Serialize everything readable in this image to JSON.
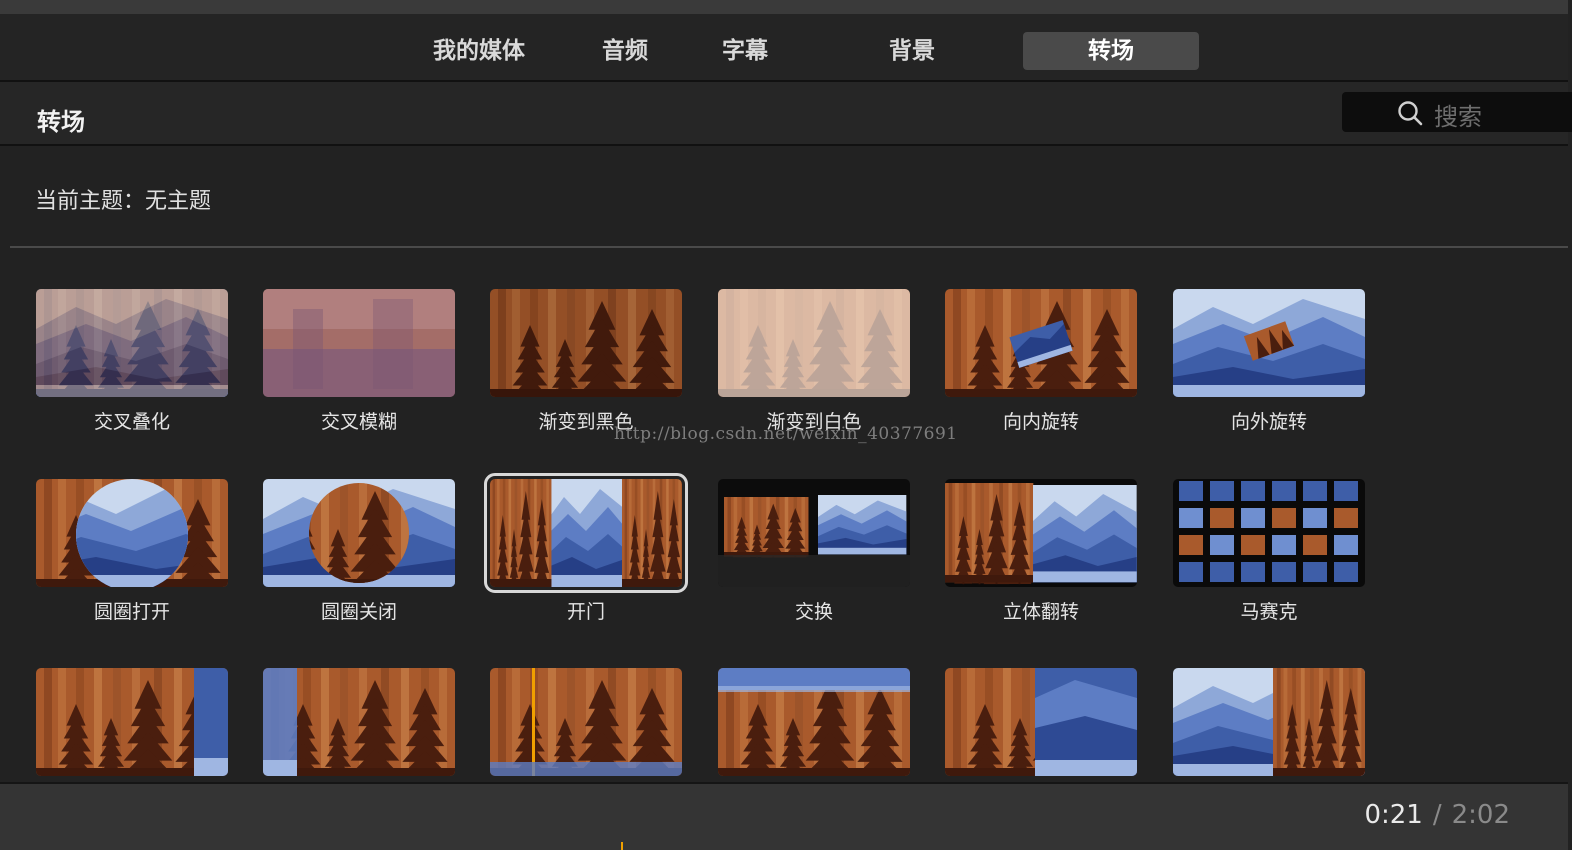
{
  "tabs": [
    {
      "label": "我的媒体"
    },
    {
      "label": "音频"
    },
    {
      "label": "字幕"
    },
    {
      "label": "背景"
    },
    {
      "label": "转场",
      "active": true
    }
  ],
  "header": {
    "title": "转场",
    "search_placeholder": "搜索"
  },
  "theme": {
    "text": "当前主题：无主题"
  },
  "watermark": "http://blog.csdn.net/weixin_40377691",
  "transitions": [
    {
      "label": "交叉叠化",
      "thumb": "crossdissolve"
    },
    {
      "label": "交叉模糊",
      "thumb": "crossblur"
    },
    {
      "label": "渐变到黑色",
      "thumb": "fadeblack"
    },
    {
      "label": "渐变到白色",
      "thumb": "fadewhite"
    },
    {
      "label": "向内旋转",
      "thumb": "spinin"
    },
    {
      "label": "向外旋转",
      "thumb": "spinout"
    },
    {
      "label": "圆圈打开",
      "thumb": "circleopen"
    },
    {
      "label": "圆圈关闭",
      "thumb": "circleclose"
    },
    {
      "label": "开门",
      "thumb": "doors",
      "selected": true
    },
    {
      "label": "交换",
      "thumb": "swap"
    },
    {
      "label": "立体翻转",
      "thumb": "cube"
    },
    {
      "label": "马赛克",
      "thumb": "mosaic"
    },
    {
      "label": "",
      "thumb": "wipeleft"
    },
    {
      "label": "",
      "thumb": "wiperight"
    },
    {
      "label": "",
      "thumb": "wipeline"
    },
    {
      "label": "",
      "thumb": "wipetop"
    },
    {
      "label": "",
      "thumb": "pushleft"
    },
    {
      "label": "",
      "thumb": "pushright"
    }
  ],
  "footer": {
    "current": "0:21",
    "separator": "/",
    "total": "2:02"
  },
  "colors": {
    "forest": "#a5582c",
    "mountain": "#3e5ea8",
    "accent": "#f0a000"
  }
}
